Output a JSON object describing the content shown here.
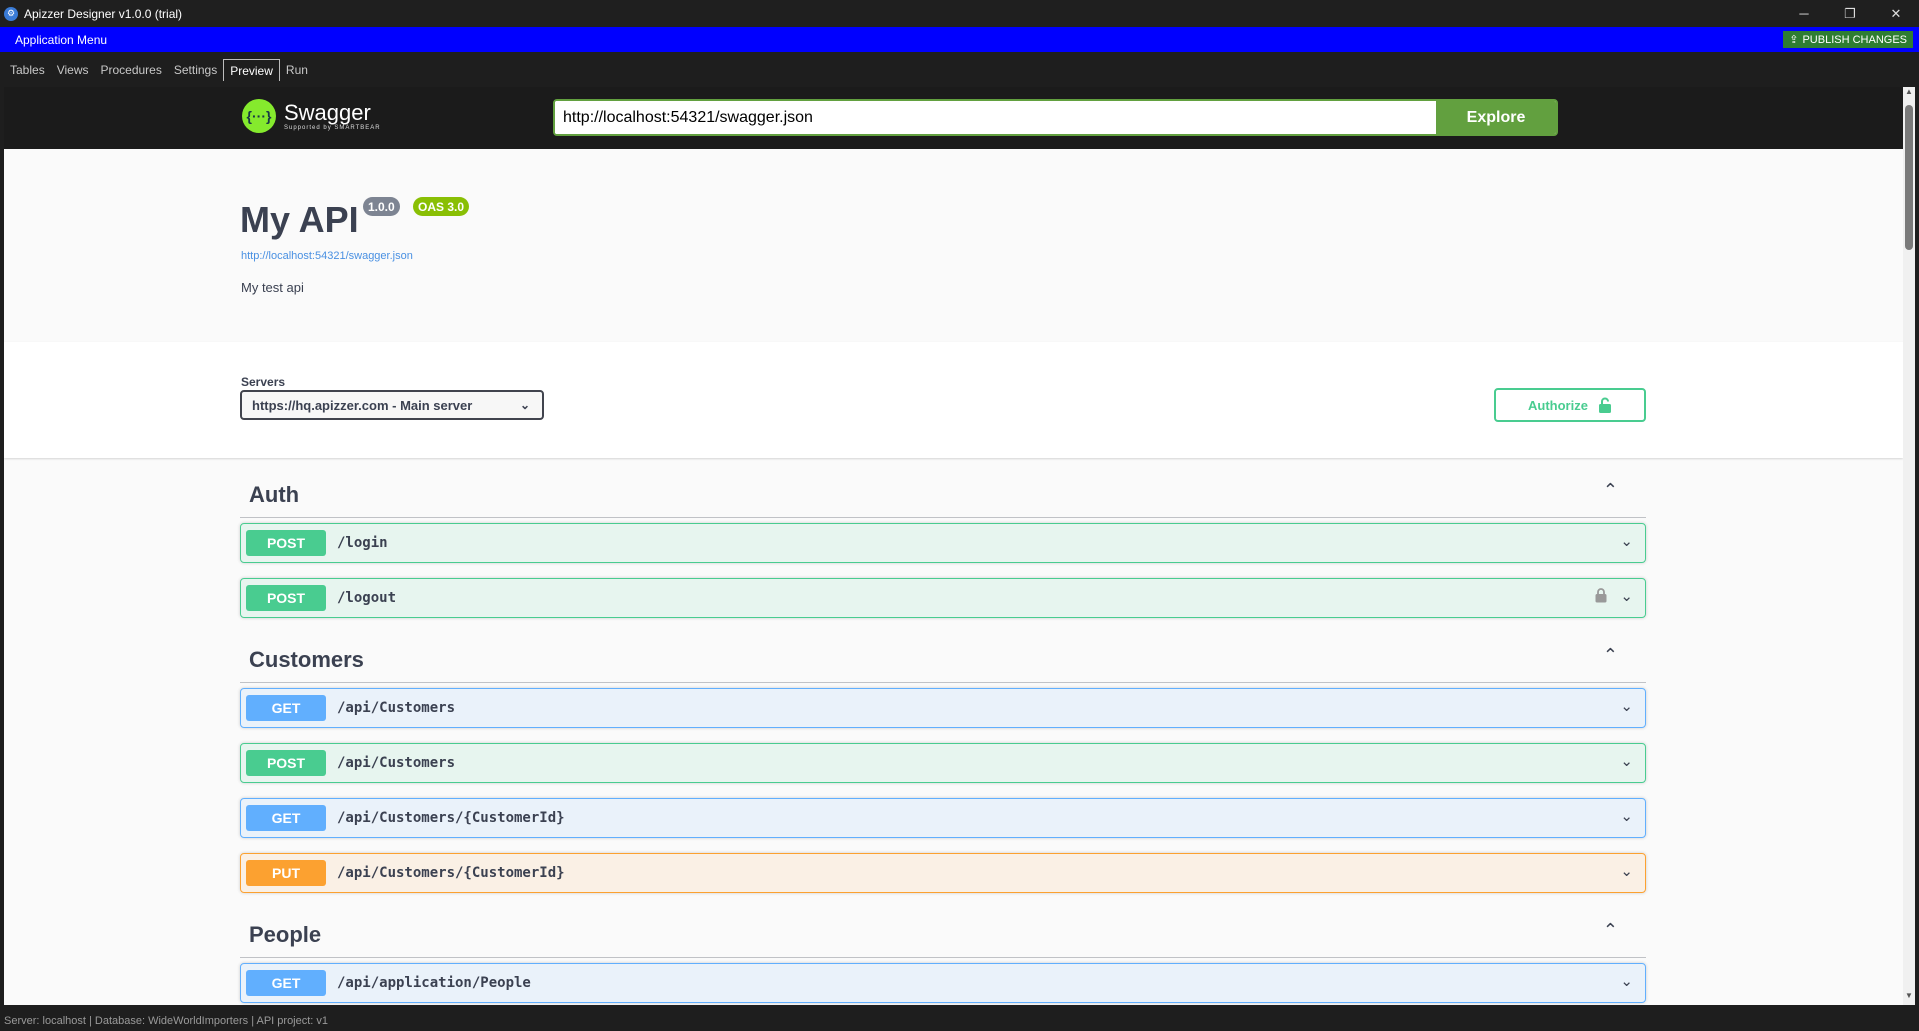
{
  "window": {
    "title": "Apizzer Designer v1.0.0 (trial)",
    "controls": [
      "─",
      "❐",
      "✕"
    ]
  },
  "menubar": {
    "app_menu": "Application Menu",
    "publish": "PUBLISH CHANGES"
  },
  "tabs": [
    {
      "label": "Tables",
      "active": false
    },
    {
      "label": "Views",
      "active": false
    },
    {
      "label": "Procedures",
      "active": false
    },
    {
      "label": "Settings",
      "active": false
    },
    {
      "label": "Preview",
      "active": true
    },
    {
      "label": "Run",
      "active": false
    }
  ],
  "swagger": {
    "logo_text": "Swagger",
    "logo_sub": "Supported by SMARTBEAR",
    "url_value": "http://localhost:54321/swagger.json",
    "explore_label": "Explore"
  },
  "info": {
    "title": "My API",
    "version": "1.0.0",
    "oas": "OAS 3.0",
    "link": "http://localhost:54321/swagger.json",
    "description": "My test api"
  },
  "servers": {
    "label": "Servers",
    "selected": "https://hq.apizzer.com - Main server",
    "authorize_label": "Authorize"
  },
  "tags": [
    {
      "name": "Auth",
      "operations": [
        {
          "method": "POST",
          "path": "/login",
          "locked": false
        },
        {
          "method": "POST",
          "path": "/logout",
          "locked": true
        }
      ]
    },
    {
      "name": "Customers",
      "operations": [
        {
          "method": "GET",
          "path": "/api/Customers",
          "locked": false
        },
        {
          "method": "POST",
          "path": "/api/Customers",
          "locked": false
        },
        {
          "method": "GET",
          "path": "/api/Customers/{CustomerId}",
          "locked": false
        },
        {
          "method": "PUT",
          "path": "/api/Customers/{CustomerId}",
          "locked": false
        }
      ]
    },
    {
      "name": "People",
      "operations": [
        {
          "method": "GET",
          "path": "/api/application/People",
          "locked": false
        }
      ]
    }
  ],
  "statusbar": {
    "text": "Server: localhost  |  Database: WideWorldImporters  |  API project: v1"
  },
  "colors": {
    "menubar": "#0000ff",
    "publish": "#2e7d32",
    "post": "#49cc90",
    "get": "#61affe",
    "put": "#fca130",
    "explore": "#62a03f"
  }
}
